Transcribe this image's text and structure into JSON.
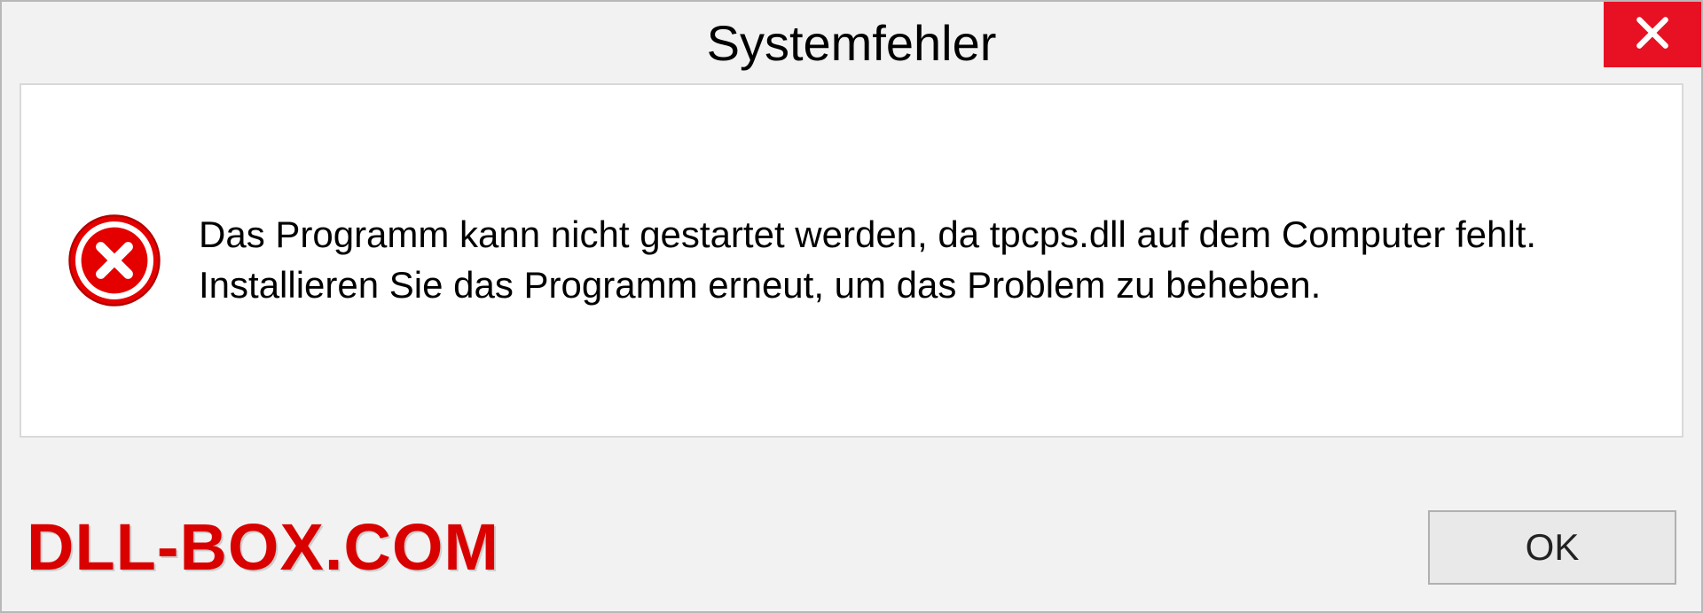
{
  "dialog": {
    "title": "Systemfehler",
    "message": "Das Programm kann nicht gestartet werden, da tpcps.dll auf dem Computer fehlt. Installieren Sie das Programm erneut, um das Problem zu beheben.",
    "ok_label": "OK"
  },
  "watermark": "DLL-BOX.COM",
  "colors": {
    "close_button": "#e81123",
    "error_icon": "#e50000",
    "watermark": "#d90000"
  }
}
